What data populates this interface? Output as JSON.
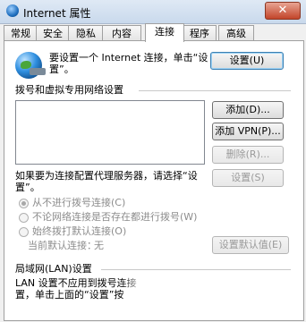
{
  "window": {
    "title": "Internet 属性",
    "close_label": "✕"
  },
  "tabs": [
    {
      "label": "常规"
    },
    {
      "label": "安全"
    },
    {
      "label": "隐私"
    },
    {
      "label": "内容"
    },
    {
      "label": "连接"
    },
    {
      "label": "程序"
    },
    {
      "label": "高级"
    }
  ],
  "setup": {
    "text_line1": "要设置一个 Internet 连接，单击“设",
    "text_line2": "置”。",
    "button": "设置(U)"
  },
  "dialup": {
    "section_title": "拨号和虚拟专用网络设置",
    "add_button": "添加(D)...",
    "add_vpn_button": "添加 VPN(P)...",
    "delete_button": "删除(R)...",
    "proxy_text_line1": "如果要为连接配置代理服务器，请选择“设",
    "proxy_text_line2": "置”。",
    "settings_button": "设置(S)",
    "radio_never": "从不进行拨号连接(C)",
    "radio_when_none": "不论网络连接是否存在都进行拨号(W)",
    "radio_always": "始终拨打默认连接(O)",
    "default_label": "当前默认连接：",
    "default_value": "无",
    "set_default_button": "设置默认值(E)"
  },
  "lan": {
    "section_title": "局域网(LAN)设置",
    "text_line1": "LAN 设置不应用到拨号连接",
    "text_line2": "置，单击上面的“设置”按"
  }
}
